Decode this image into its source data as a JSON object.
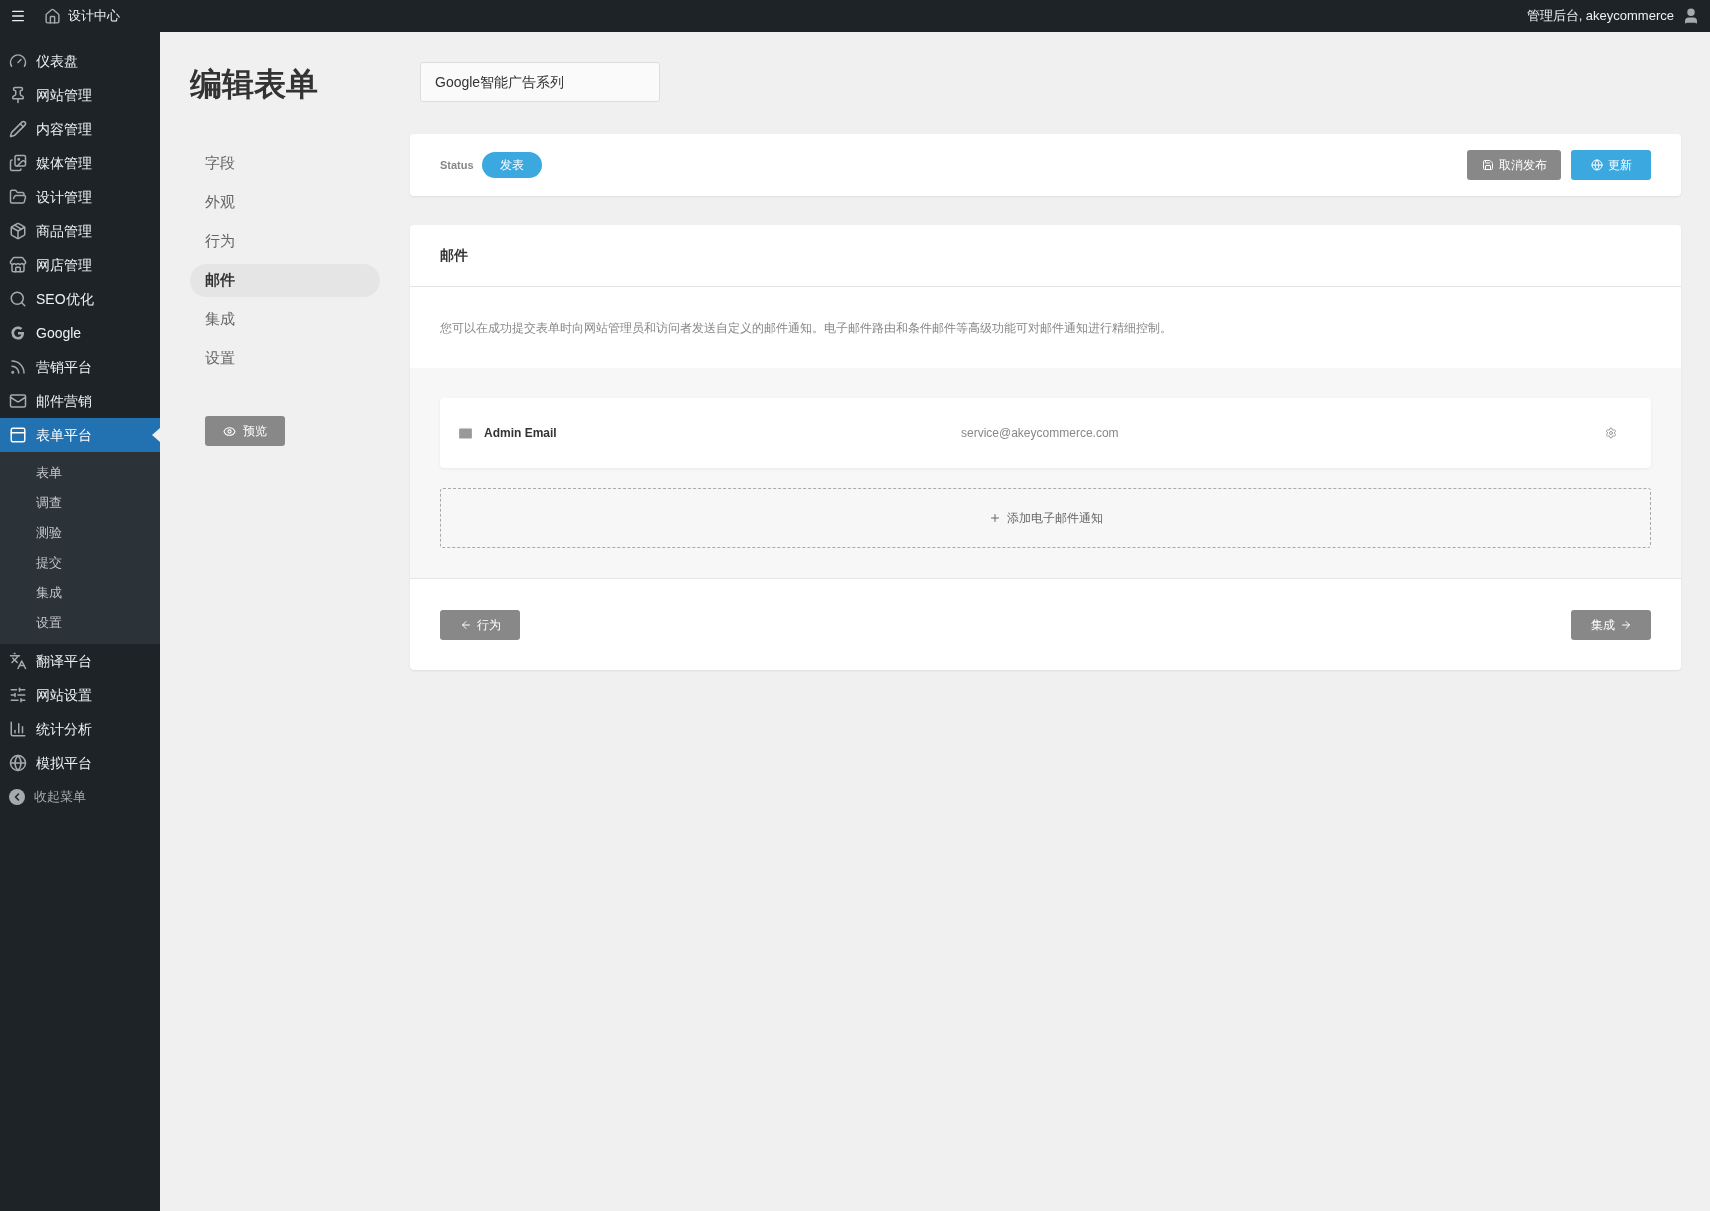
{
  "topbar": {
    "site": "设计中心",
    "user": "管理后台, akeycommerce"
  },
  "sidebar": {
    "items": [
      {
        "label": "仪表盘",
        "selected": false
      },
      {
        "label": "网站管理",
        "selected": false
      },
      {
        "label": "内容管理",
        "selected": false
      },
      {
        "label": "媒体管理",
        "selected": false
      },
      {
        "label": "设计管理",
        "selected": false
      },
      {
        "label": "商品管理",
        "selected": false
      },
      {
        "label": "网店管理",
        "selected": false
      },
      {
        "label": "SEO优化",
        "selected": false
      },
      {
        "label": "Google",
        "selected": false
      },
      {
        "label": "营销平台",
        "selected": false
      },
      {
        "label": "邮件营销",
        "selected": false
      },
      {
        "label": "表单平台",
        "selected": true,
        "children": [
          "表单",
          "调查",
          "测验",
          "提交",
          "集成",
          "设置"
        ]
      },
      {
        "label": "翻译平台",
        "selected": false
      },
      {
        "label": "网站设置",
        "selected": false
      },
      {
        "label": "统计分析",
        "selected": false
      },
      {
        "label": "模拟平台",
        "selected": false
      }
    ],
    "collapse": "收起菜单"
  },
  "page": {
    "title": "编辑表单",
    "form_name": "Google智能广告系列"
  },
  "form_nav": {
    "items": [
      {
        "label": "字段",
        "selected": false
      },
      {
        "label": "外观",
        "selected": false
      },
      {
        "label": "行为",
        "selected": false
      },
      {
        "label": "邮件",
        "selected": true
      },
      {
        "label": "集成",
        "selected": false
      },
      {
        "label": "设置",
        "selected": false
      }
    ],
    "preview_button": "预览"
  },
  "status_bar": {
    "label": "Status",
    "status": "发表",
    "unpublish_button": "取消发布",
    "update_button": "更新"
  },
  "email_panel": {
    "title": "邮件",
    "description": "您可以在成功提交表单时向网站管理员和访问者发送自定义的邮件通知。电子邮件路由和条件邮件等高级功能可对邮件通知进行精细控制。",
    "notifications": [
      {
        "name": "Admin Email",
        "address": "service@akeycommerce.com"
      }
    ],
    "add_button": "添加电子邮件通知",
    "back_button": "行为",
    "next_button": "集成"
  }
}
